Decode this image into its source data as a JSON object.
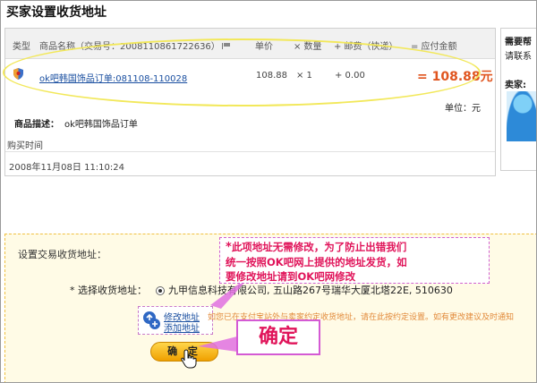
{
  "page": {
    "title": "买家设置收货地址"
  },
  "order": {
    "headers": {
      "type": "类型",
      "name": "商品名称（交易号：2008110861722636）",
      "price": "单价",
      "qty": "× 数量",
      "shipping": "+ 邮费（快递）",
      "total": "= 应付金额"
    },
    "row": {
      "link": "ok吧韩国饰品订单:081108-110028",
      "price": "108.88",
      "qty": "× 1",
      "shipping": "+ 0.00",
      "total": "= 108.88元"
    },
    "unit": "单位：元",
    "desc_label": "商品描述：",
    "desc_value": "ok吧韩国饰品订单",
    "time_label": "购买时间",
    "time_value": "2008年11月08日 11:10:24"
  },
  "side": {
    "title": "需要帮",
    "link": "请联系",
    "seller": "卖家:"
  },
  "address": {
    "title": "设置交易收货地址：",
    "select_label": "* 选择收货地址：",
    "selected_address": "九甲信息科技有限公司, 五山路267号瑞华大厦北塔22E, 510630",
    "edit_link": "修改地址",
    "add_link": "添加地址",
    "notice": "如您已在支付宝站外与卖家约定收货地址，请在此按约定设置。如有更改建议及时通知",
    "confirm_label": "确 定"
  },
  "annotations": {
    "callout_star": "*",
    "callout_line1": "此项地址无需修改，为了防止出错我们",
    "callout_line2": "统一按照OK吧网上提供的地址发货，如",
    "callout_line3": "要修改地址请到OK吧网修改",
    "big_label": "确定"
  },
  "colors": {
    "total": "#e0551f",
    "annotation": "#e0145a",
    "ellipse": "#f2e85a",
    "link": "#1a4fa0"
  }
}
